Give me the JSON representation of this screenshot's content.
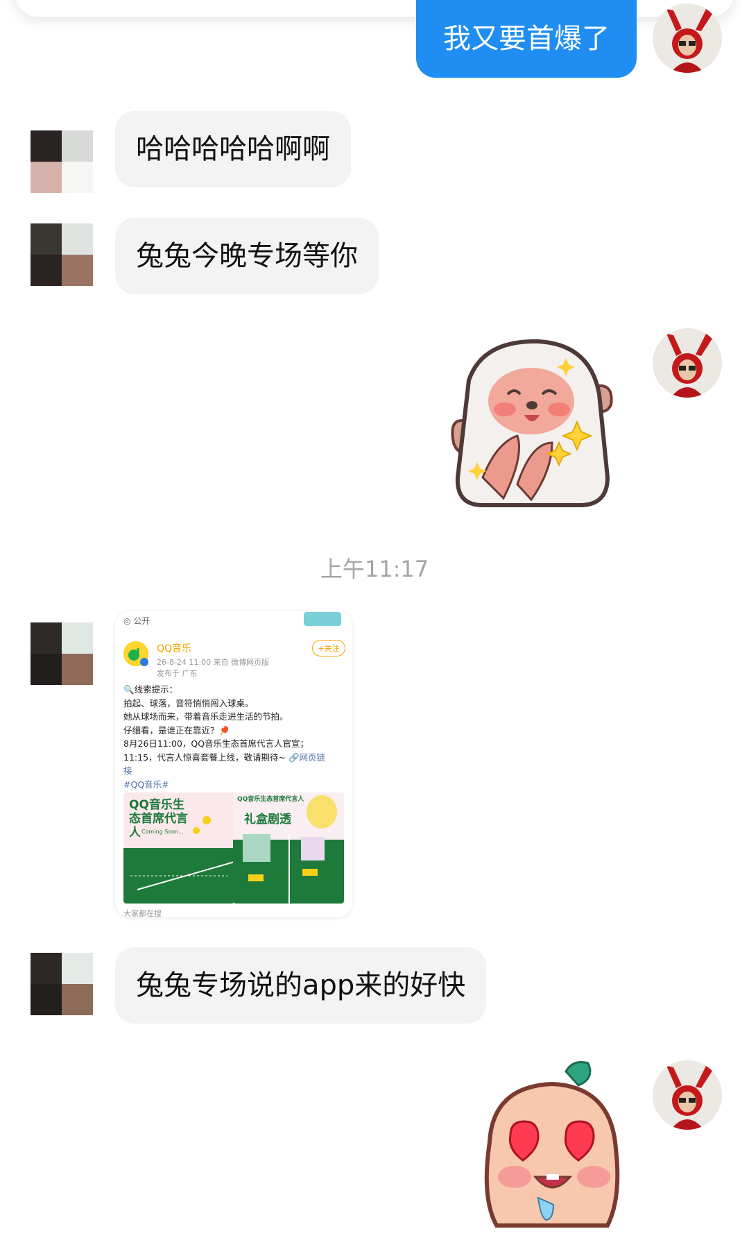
{
  "messages": {
    "m1": "我又要首爆了",
    "m2": "哈哈哈哈哈啊啊",
    "m3": "兔兔今晚专场等你",
    "time": "上午11:17",
    "m4": "兔兔专场说的app来的好快"
  },
  "post": {
    "visibility": "公开",
    "author": "QQ音乐",
    "time_source": "26-8-24 11:00  来自 微博网页版",
    "location": "发布于 广东",
    "follow": "+关注",
    "line1": "🔍线索提示：",
    "line2": "拍起、球落，音符悄悄闯入球桌。",
    "line3": "她从球场而来，带着音乐走进生活的节拍。",
    "line4": "仔细看，是谁正在靠近？🏓",
    "line5": "8月26日11:00，QQ音乐生态首席代言人官宣；",
    "line6a": "11:15，代言人惊喜套餐上线，敬请期待~ ",
    "link": "🔗网页链",
    "line7": "接",
    "tag": "#QQ音乐#",
    "img1_text": "QQ音乐生态首席代言人",
    "img1_sub": "Coming Soon...",
    "img2_top": "QQ音乐生态首席代言人",
    "img2_text": "礼盒剧透",
    "footer": "大家都在搜"
  },
  "colors": {
    "outgoing_bubble": "#1f8df2",
    "incoming_bubble": "#f3f3f3",
    "timestamp": "#a4a4a4",
    "brand_green": "#1e7a3a",
    "brand_yellow": "#f5a300"
  }
}
